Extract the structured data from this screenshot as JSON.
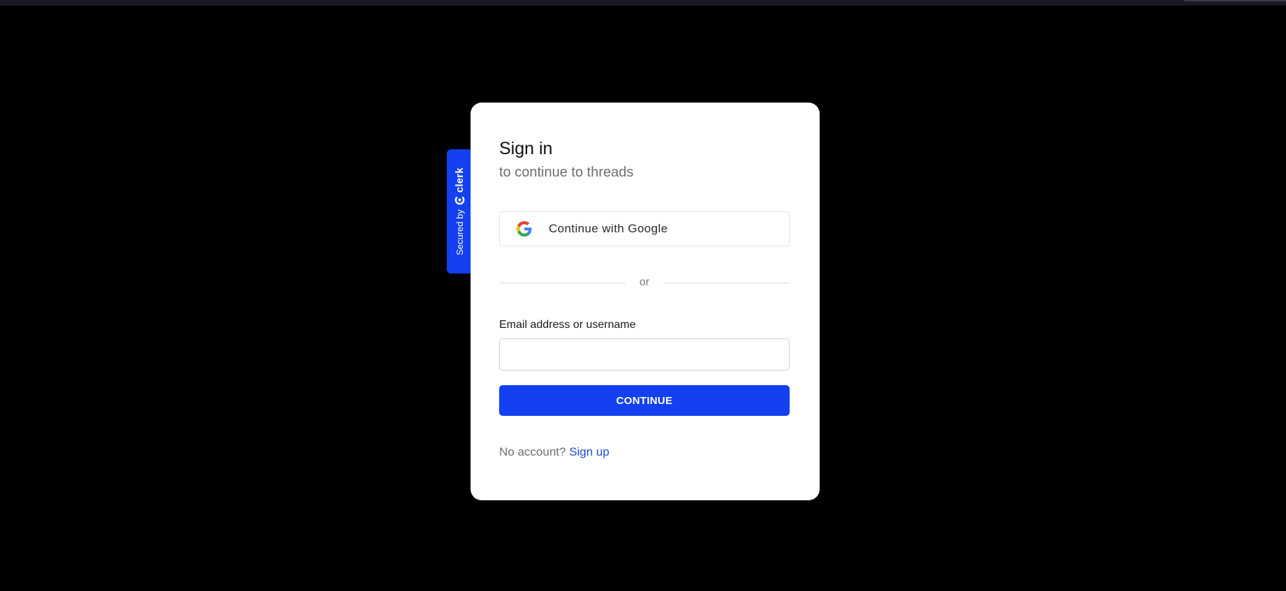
{
  "badge": {
    "secured_text": "Secured by",
    "brand_text": "clerk",
    "brand_icon": "clerk-logo-icon"
  },
  "card": {
    "title": "Sign in",
    "subtitle": "to continue to threads",
    "google_button": {
      "label": "Continue with Google",
      "icon": "google-icon"
    },
    "divider_text": "or",
    "email_field": {
      "label": "Email address or username",
      "value": "",
      "placeholder": ""
    },
    "continue_label": "CONTINUE",
    "footer": {
      "prompt": "No account?",
      "link_label": "Sign up"
    }
  },
  "colors": {
    "background": "#000000",
    "accent": "#1340f0",
    "link": "#1f4bd8"
  }
}
